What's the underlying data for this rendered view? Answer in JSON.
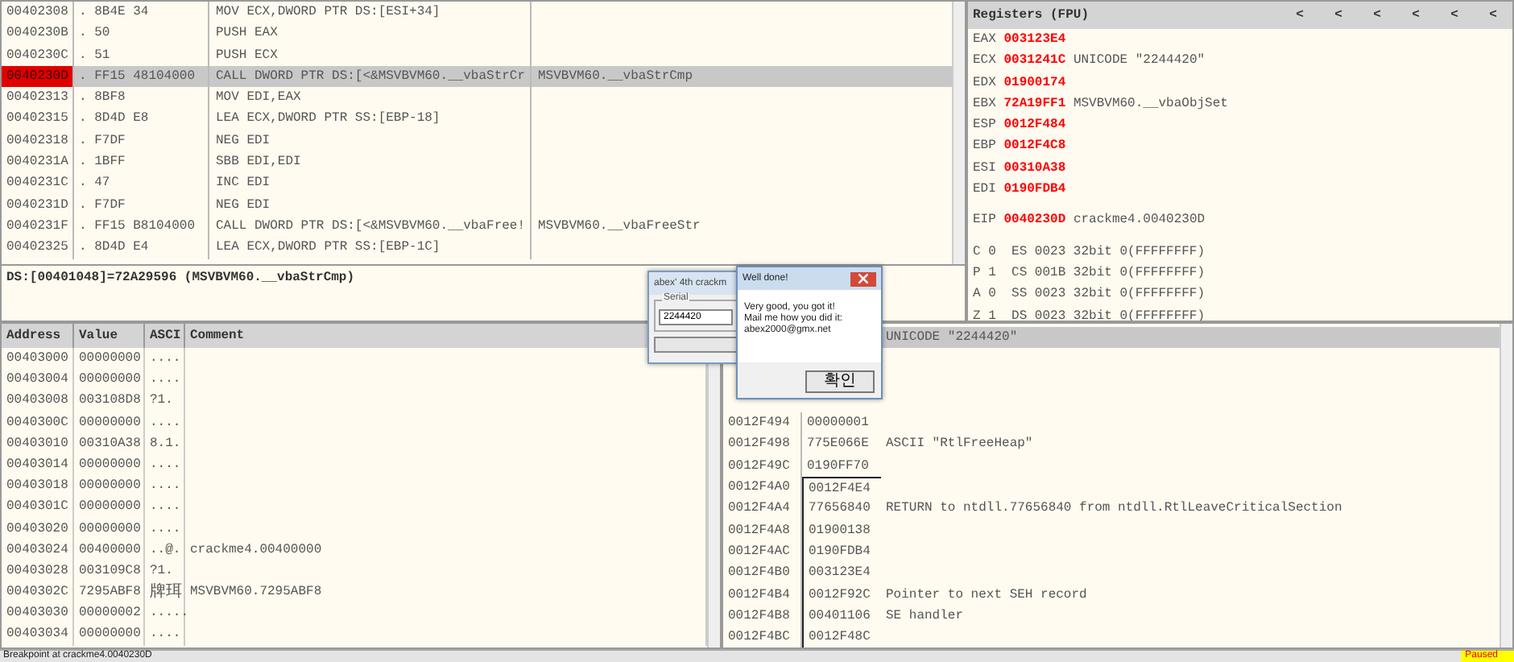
{
  "disassembly": {
    "rows": [
      {
        "address": "00402308",
        "hex": ". 8B4E 34",
        "command": "MOV ECX,DWORD PTR DS:[ESI+34]",
        "comment": "",
        "selected": false
      },
      {
        "address": "0040230B",
        "hex": ". 50",
        "command": "PUSH EAX",
        "selected": false
      },
      {
        "address": "0040230C",
        "hex": ". 51",
        "command": "PUSH ECX",
        "selected": false
      },
      {
        "address": "0040230D",
        "hex": ". FF15 48104000",
        "command": "CALL DWORD PTR DS:[<&MSVBVM60.__vbaStrCr",
        "comment": "MSVBVM60.__vbaStrCmp",
        "selected": true
      },
      {
        "address": "00402313",
        "hex": ". 8BF8",
        "command": "MOV EDI,EAX",
        "selected": false
      },
      {
        "address": "00402315",
        "hex": ". 8D4D E8",
        "command": "LEA ECX,DWORD PTR SS:[EBP-18]",
        "selected": false
      },
      {
        "address": "00402318",
        "hex": ". F7DF",
        "command": "NEG EDI",
        "selected": false
      },
      {
        "address": "0040231A",
        "hex": ". 1BFF",
        "command": "SBB EDI,EDI",
        "selected": false
      },
      {
        "address": "0040231C",
        "hex": ". 47",
        "command": "INC EDI",
        "selected": false
      },
      {
        "address": "0040231D",
        "hex": ". F7DF",
        "command": "NEG EDI",
        "selected": false
      },
      {
        "address": "0040231F",
        "hex": ". FF15 B8104000",
        "command": "CALL DWORD PTR DS:[<&MSVBVM60.__vbaFree!",
        "comment": "MSVBVM60.__vbaFreeStr",
        "selected": false
      },
      {
        "address": "00402325",
        "hex": ". 8D4D E4",
        "command": "LEA ECX,DWORD PTR SS:[EBP-1C]",
        "selected": false
      }
    ]
  },
  "info_line": "DS:[00401048]=72A29596 (MSVBVM60.__vbaStrCmp)",
  "registers": {
    "title": "Registers (FPU)",
    "nav_buttons": [
      "<",
      "<",
      "<",
      "<",
      "<",
      "<"
    ],
    "rows": [
      {
        "name": "EAX",
        "value": "003123E4"
      },
      {
        "name": "ECX",
        "value": "0031241C",
        "comment": "UNICODE \"2244420\""
      },
      {
        "name": "EDX",
        "value": "01900174"
      },
      {
        "name": "EBX",
        "value": "72A19FF1",
        "comment": "MSVBVM60.__vbaObjSet"
      },
      {
        "name": "ESP",
        "value": "0012F484"
      },
      {
        "name": "EBP",
        "value": "0012F4C8"
      },
      {
        "name": "ESI",
        "value": "00310A38"
      },
      {
        "name": "EDI",
        "value": "0190FDB4"
      }
    ],
    "eip": {
      "name": "EIP",
      "value": "0040230D",
      "comment": "crackme4.0040230D"
    },
    "flags": [
      {
        "flag": "C",
        "bit": "0",
        "segment": "ES",
        "selector": "0023",
        "mode": "32bit",
        "base": "0(FFFFFFFF)"
      },
      {
        "flag": "P",
        "bit": "1",
        "segment": "CS",
        "selector": "001B",
        "mode": "32bit",
        "base": "0(FFFFFFFF)"
      },
      {
        "flag": "A",
        "bit": "0",
        "segment": "SS",
        "selector": "0023",
        "mode": "32bit",
        "base": "0(FFFFFFFF)"
      },
      {
        "flag": "Z",
        "bit": "1",
        "segment": "DS",
        "selector": "0023",
        "mode": "32bit",
        "base": "0(FFFFFFFF)"
      }
    ]
  },
  "dump": {
    "columns": [
      "Address",
      "Value",
      "ASCI",
      "Comment"
    ],
    "rows": [
      {
        "address": "00403000",
        "value": "00000000",
        "ascii": "...."
      },
      {
        "address": "00403004",
        "value": "00000000",
        "ascii": "...."
      },
      {
        "address": "00403008",
        "value": "003108D8",
        "ascii": "?1."
      },
      {
        "address": "0040300C",
        "value": "00000000",
        "ascii": "...."
      },
      {
        "address": "00403010",
        "value": "00310A38",
        "ascii": "8.1."
      },
      {
        "address": "00403014",
        "value": "00000000",
        "ascii": "...."
      },
      {
        "address": "00403018",
        "value": "00000000",
        "ascii": "...."
      },
      {
        "address": "0040301C",
        "value": "00000000",
        "ascii": "...."
      },
      {
        "address": "00403020",
        "value": "00000000",
        "ascii": "...."
      },
      {
        "address": "00403024",
        "value": "00400000",
        "ascii": "..@.",
        "comment": "crackme4.00400000"
      },
      {
        "address": "00403028",
        "value": "003109C8",
        "ascii": "?1."
      },
      {
        "address": "0040302C",
        "value": "7295ABF8",
        "ascii": "牌珥",
        "comment": "MSVBVM60.7295ABF8"
      },
      {
        "address": "00403030",
        "value": "00000002",
        "ascii": "....."
      },
      {
        "address": "00403034",
        "value": "00000000",
        "ascii": "...."
      }
    ]
  },
  "stack": {
    "rows": [
      {
        "comment": "UNICODE \"2244420\"",
        "selected": true,
        "bracket": false
      },
      {
        "address": "0012F494",
        "value": "00000001",
        "selected": false,
        "bracket": false
      },
      {
        "address": "0012F498",
        "value": "775E066E",
        "comment": "ASCII \"RtlFreeHeap\"",
        "selected": false,
        "bracket": false
      },
      {
        "address": "0012F49C",
        "value": "0190FF70",
        "selected": false,
        "bracket": false
      },
      {
        "address": "0012F4A0",
        "value": "0012F4E4",
        "bracket": true,
        "selected": false
      },
      {
        "address": "0012F4A4",
        "value": "77656840",
        "comment": "RETURN to ntdll.77656840 from ntdll.RtlLeaveCriticalSection",
        "bracket": true,
        "selected": false
      },
      {
        "address": "0012F4A8",
        "value": "01900138",
        "bracket": true,
        "selected": false
      },
      {
        "address": "0012F4AC",
        "value": "0190FDB4",
        "bracket": true,
        "selected": false
      },
      {
        "address": "0012F4B0",
        "value": "003123E4",
        "bracket": true,
        "selected": false
      },
      {
        "address": "0012F4B4",
        "value": "0012F92C",
        "comment": "Pointer to next SEH record",
        "bracket": true,
        "selected": false
      },
      {
        "address": "0012F4B8",
        "value": "00401106",
        "comment": "SE handler",
        "bracket": true,
        "selected": false
      },
      {
        "address": "0012F4BC",
        "value": "0012F48C",
        "bracket": true,
        "selected": false
      }
    ]
  },
  "crackme_window": {
    "title": "abex' 4th crackm",
    "group": "Serial",
    "serial": "2244420"
  },
  "message_box": {
    "title": "Well done!",
    "lines": [
      "Very good, you got it!",
      "Mail me how you did it:",
      "abex2000@gmx.net"
    ],
    "button": "확인"
  },
  "status_bar": {
    "message": "Breakpoint at crackme4.0040230D",
    "state": "Paused"
  }
}
